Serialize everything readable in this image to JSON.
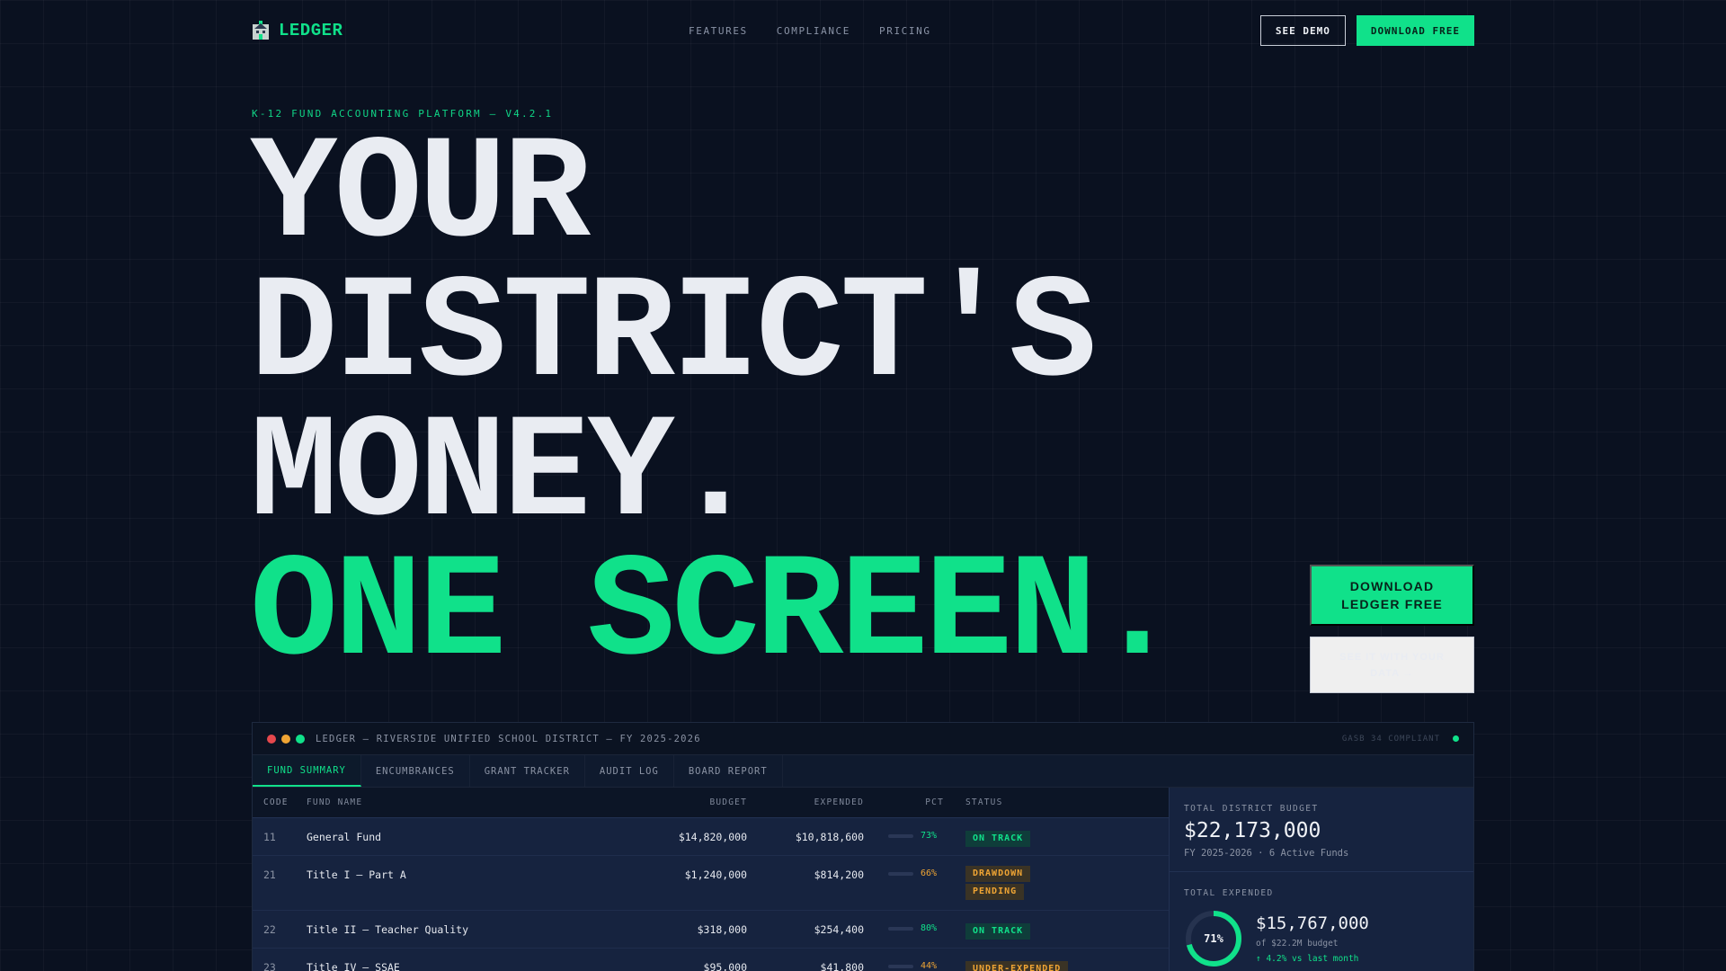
{
  "nav": {
    "brand": "LEDGER",
    "links": [
      "FEATURES",
      "COMPLIANCE",
      "PRICING"
    ],
    "demo_label": "SEE DEMO",
    "download_label": "DOWNLOAD FREE"
  },
  "hero": {
    "eyebrow": "K-12 FUND ACCOUNTING PLATFORM — V4.2.1",
    "line1": "YOUR",
    "line2": "DISTRICT'S",
    "line3": "MONEY.",
    "line4": "ONE SCREEN.",
    "cta_primary": "DOWNLOAD LEDGER FREE",
    "cta_secondary": "SEE IT WITH YOUR DATA →"
  },
  "colors": {
    "accent": "#10e18a",
    "amber": "#f0a534",
    "bg": "#0a1120"
  },
  "app": {
    "title": "LEDGER — RIVERSIDE UNIFIED SCHOOL DISTRICT — FY 2025-2026",
    "compliance": "GASB 34 COMPLIANT",
    "tabs": [
      "FUND SUMMARY",
      "ENCUMBRANCES",
      "GRANT TRACKER",
      "AUDIT LOG",
      "BOARD REPORT"
    ],
    "columns": {
      "code": "CODE",
      "name": "FUND NAME",
      "budget": "BUDGET",
      "expended": "EXPENDED",
      "pct": "PCT",
      "status": "STATUS"
    },
    "rows": [
      {
        "code": "11",
        "name": "General Fund",
        "budget": "$14,820,000",
        "expended": "$10,818,600",
        "pct": "73%",
        "pct_value": 0.73,
        "status": "ON TRACK",
        "tone": "green"
      },
      {
        "code": "21",
        "name": "Title I — Part A",
        "budget": "$1,240,000",
        "expended": "$814,200",
        "pct": "66%",
        "pct_value": 0.66,
        "status": "DRAWDOWN PENDING",
        "tone": "amber"
      },
      {
        "code": "22",
        "name": "Title II — Teacher Quality",
        "budget": "$318,000",
        "expended": "$254,400",
        "pct": "80%",
        "pct_value": 0.8,
        "status": "ON TRACK",
        "tone": "green"
      },
      {
        "code": "23",
        "name": "Title IV — SSAE",
        "budget": "$95,000",
        "expended": "$41,800",
        "pct": "44%",
        "pct_value": 0.44,
        "status": "UNDER-EXPENDED",
        "tone": "amber"
      }
    ],
    "side": {
      "budget_label": "TOTAL DISTRICT BUDGET",
      "budget_value": "$22,173,000",
      "budget_sub": "FY 2025-2026 · 6 Active Funds",
      "expended_label": "TOTAL EXPENDED",
      "expended_pct": "71%",
      "expended_pct_value": 0.71,
      "expended_value": "$15,767,000",
      "expended_sub": "of $22.2M budget",
      "expended_trend": "↑ 4.2% vs last month"
    }
  }
}
